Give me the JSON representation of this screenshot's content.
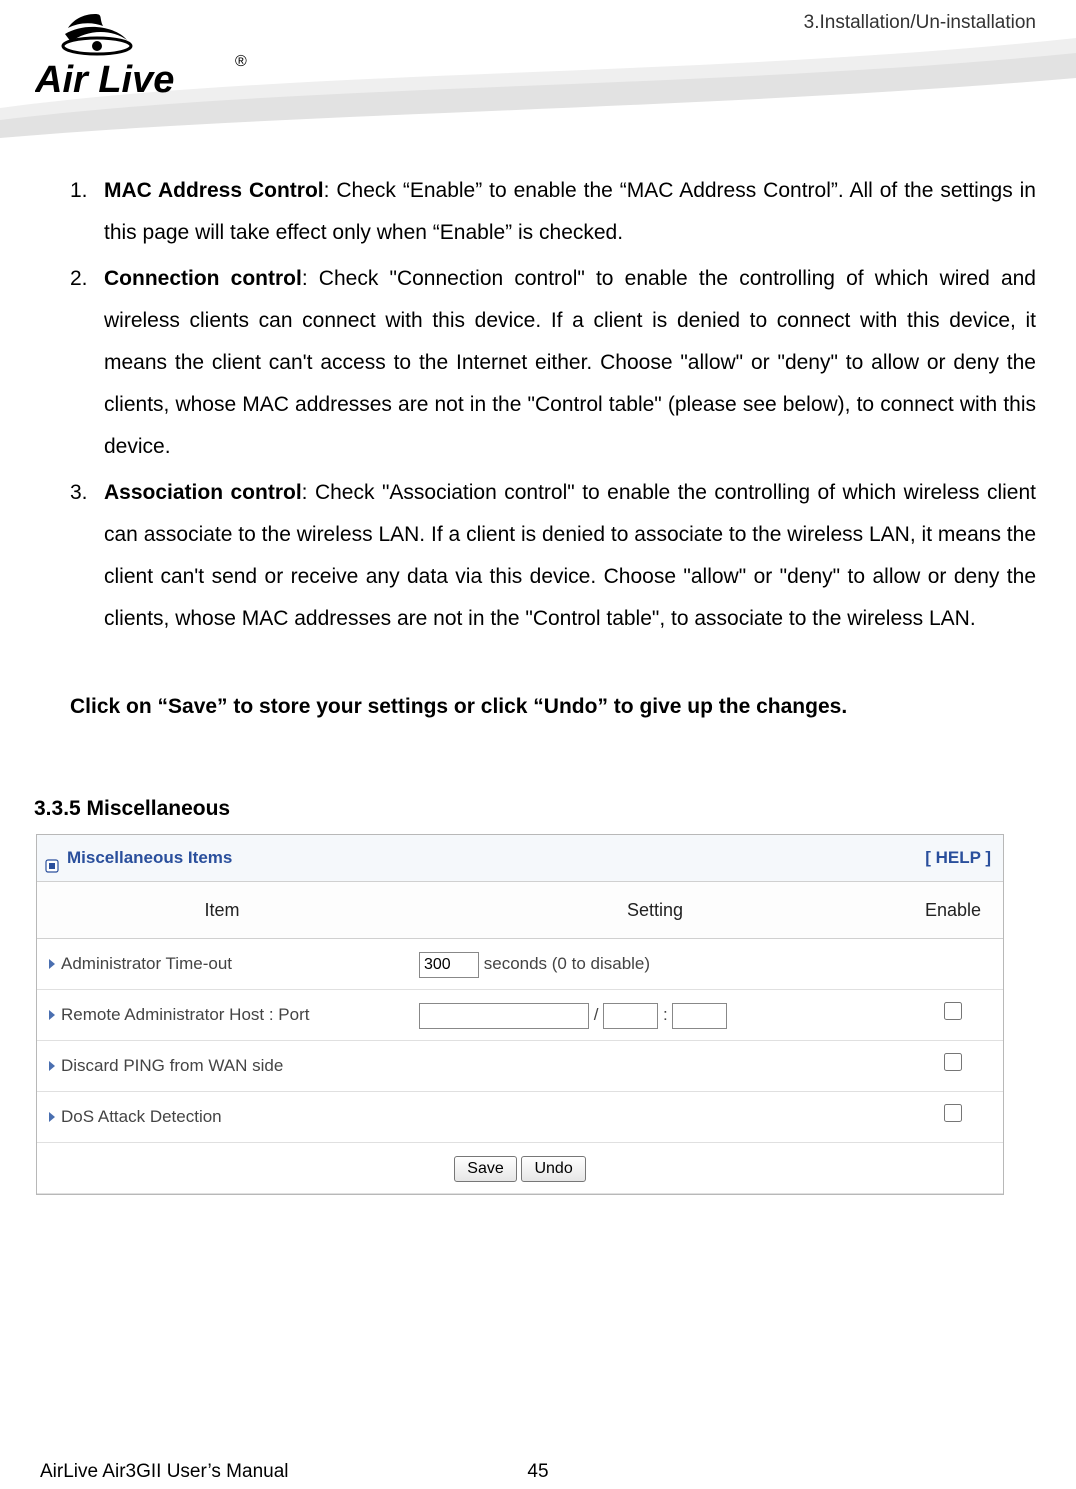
{
  "header": {
    "breadcrumb": "3.Installation/Un-installation",
    "logo_main": "Air Live",
    "logo_reg": "®"
  },
  "list": {
    "items": [
      {
        "num": "1.",
        "lead": "MAC Address Control",
        "body": ": Check “Enable” to enable the “MAC Address Control”. All of the settings in this page will take effect only when “Enable” is checked."
      },
      {
        "num": "2.",
        "lead": "Connection control",
        "body": ": Check \"Connection control\" to enable the controlling of which wired and wireless clients can connect with this device. If a client is denied to connect with this device, it means the client can't access to the Internet either. Choose \"allow\" or \"deny\" to allow or deny the clients, whose MAC addresses are not in the \"Control table\" (please see below), to connect with this device."
      },
      {
        "num": "3.",
        "lead": "Association control",
        "body": ": Check \"Association control\" to enable the controlling of which wireless client can associate to the wireless LAN. If a client is denied to associate to the wireless LAN, it means the client can't send or receive any data via this device. Choose \"allow\" or \"deny\" to allow or deny the clients, whose MAC addresses are not in the \"Control table\", to associate to the wireless LAN."
      }
    ],
    "save_note": "Click on “Save” to store your settings or click “Undo” to give up the changes."
  },
  "section": {
    "heading": "3.3.5 Miscellaneous",
    "panel_title": "Miscellaneous Items",
    "help": "[ HELP ]",
    "columns": {
      "item": "Item",
      "setting": "Setting",
      "enable": "Enable"
    },
    "rows": {
      "timeout": {
        "label": "Administrator Time-out",
        "value": "300",
        "suffix": "seconds (0 to disable)"
      },
      "remote": {
        "label": "Remote Administrator Host : Port",
        "sep1": "/",
        "sep2": ":"
      },
      "ping": {
        "label": "Discard PING from WAN side"
      },
      "dos": {
        "label": "DoS Attack Detection"
      }
    },
    "buttons": {
      "save": "Save",
      "undo": "Undo"
    }
  },
  "footer": {
    "left": "AirLive Air3GII User’s Manual",
    "page": "45"
  }
}
